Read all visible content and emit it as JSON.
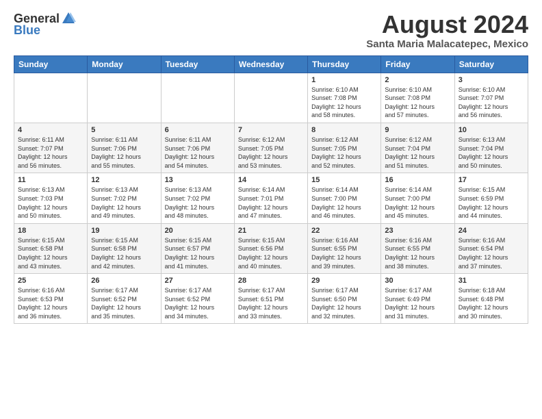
{
  "header": {
    "logo_general": "General",
    "logo_blue": "Blue",
    "month_year": "August 2024",
    "location": "Santa Maria Malacatepec, Mexico"
  },
  "weekdays": [
    "Sunday",
    "Monday",
    "Tuesday",
    "Wednesday",
    "Thursday",
    "Friday",
    "Saturday"
  ],
  "weeks": [
    [
      {
        "num": "",
        "info": ""
      },
      {
        "num": "",
        "info": ""
      },
      {
        "num": "",
        "info": ""
      },
      {
        "num": "",
        "info": ""
      },
      {
        "num": "1",
        "info": "Sunrise: 6:10 AM\nSunset: 7:08 PM\nDaylight: 12 hours\nand 58 minutes."
      },
      {
        "num": "2",
        "info": "Sunrise: 6:10 AM\nSunset: 7:08 PM\nDaylight: 12 hours\nand 57 minutes."
      },
      {
        "num": "3",
        "info": "Sunrise: 6:10 AM\nSunset: 7:07 PM\nDaylight: 12 hours\nand 56 minutes."
      }
    ],
    [
      {
        "num": "4",
        "info": "Sunrise: 6:11 AM\nSunset: 7:07 PM\nDaylight: 12 hours\nand 56 minutes."
      },
      {
        "num": "5",
        "info": "Sunrise: 6:11 AM\nSunset: 7:06 PM\nDaylight: 12 hours\nand 55 minutes."
      },
      {
        "num": "6",
        "info": "Sunrise: 6:11 AM\nSunset: 7:06 PM\nDaylight: 12 hours\nand 54 minutes."
      },
      {
        "num": "7",
        "info": "Sunrise: 6:12 AM\nSunset: 7:05 PM\nDaylight: 12 hours\nand 53 minutes."
      },
      {
        "num": "8",
        "info": "Sunrise: 6:12 AM\nSunset: 7:05 PM\nDaylight: 12 hours\nand 52 minutes."
      },
      {
        "num": "9",
        "info": "Sunrise: 6:12 AM\nSunset: 7:04 PM\nDaylight: 12 hours\nand 51 minutes."
      },
      {
        "num": "10",
        "info": "Sunrise: 6:13 AM\nSunset: 7:04 PM\nDaylight: 12 hours\nand 50 minutes."
      }
    ],
    [
      {
        "num": "11",
        "info": "Sunrise: 6:13 AM\nSunset: 7:03 PM\nDaylight: 12 hours\nand 50 minutes."
      },
      {
        "num": "12",
        "info": "Sunrise: 6:13 AM\nSunset: 7:02 PM\nDaylight: 12 hours\nand 49 minutes."
      },
      {
        "num": "13",
        "info": "Sunrise: 6:13 AM\nSunset: 7:02 PM\nDaylight: 12 hours\nand 48 minutes."
      },
      {
        "num": "14",
        "info": "Sunrise: 6:14 AM\nSunset: 7:01 PM\nDaylight: 12 hours\nand 47 minutes."
      },
      {
        "num": "15",
        "info": "Sunrise: 6:14 AM\nSunset: 7:00 PM\nDaylight: 12 hours\nand 46 minutes."
      },
      {
        "num": "16",
        "info": "Sunrise: 6:14 AM\nSunset: 7:00 PM\nDaylight: 12 hours\nand 45 minutes."
      },
      {
        "num": "17",
        "info": "Sunrise: 6:15 AM\nSunset: 6:59 PM\nDaylight: 12 hours\nand 44 minutes."
      }
    ],
    [
      {
        "num": "18",
        "info": "Sunrise: 6:15 AM\nSunset: 6:58 PM\nDaylight: 12 hours\nand 43 minutes."
      },
      {
        "num": "19",
        "info": "Sunrise: 6:15 AM\nSunset: 6:58 PM\nDaylight: 12 hours\nand 42 minutes."
      },
      {
        "num": "20",
        "info": "Sunrise: 6:15 AM\nSunset: 6:57 PM\nDaylight: 12 hours\nand 41 minutes."
      },
      {
        "num": "21",
        "info": "Sunrise: 6:15 AM\nSunset: 6:56 PM\nDaylight: 12 hours\nand 40 minutes."
      },
      {
        "num": "22",
        "info": "Sunrise: 6:16 AM\nSunset: 6:55 PM\nDaylight: 12 hours\nand 39 minutes."
      },
      {
        "num": "23",
        "info": "Sunrise: 6:16 AM\nSunset: 6:55 PM\nDaylight: 12 hours\nand 38 minutes."
      },
      {
        "num": "24",
        "info": "Sunrise: 6:16 AM\nSunset: 6:54 PM\nDaylight: 12 hours\nand 37 minutes."
      }
    ],
    [
      {
        "num": "25",
        "info": "Sunrise: 6:16 AM\nSunset: 6:53 PM\nDaylight: 12 hours\nand 36 minutes."
      },
      {
        "num": "26",
        "info": "Sunrise: 6:17 AM\nSunset: 6:52 PM\nDaylight: 12 hours\nand 35 minutes."
      },
      {
        "num": "27",
        "info": "Sunrise: 6:17 AM\nSunset: 6:52 PM\nDaylight: 12 hours\nand 34 minutes."
      },
      {
        "num": "28",
        "info": "Sunrise: 6:17 AM\nSunset: 6:51 PM\nDaylight: 12 hours\nand 33 minutes."
      },
      {
        "num": "29",
        "info": "Sunrise: 6:17 AM\nSunset: 6:50 PM\nDaylight: 12 hours\nand 32 minutes."
      },
      {
        "num": "30",
        "info": "Sunrise: 6:17 AM\nSunset: 6:49 PM\nDaylight: 12 hours\nand 31 minutes."
      },
      {
        "num": "31",
        "info": "Sunrise: 6:18 AM\nSunset: 6:48 PM\nDaylight: 12 hours\nand 30 minutes."
      }
    ]
  ]
}
